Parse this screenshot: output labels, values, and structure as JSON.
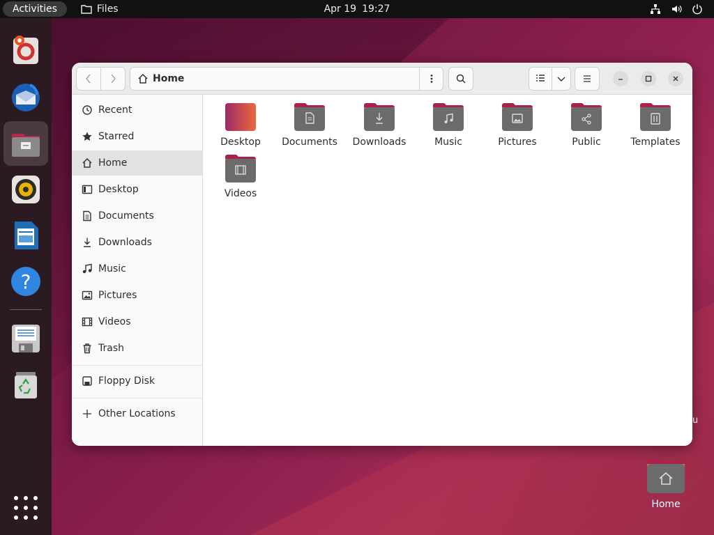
{
  "topbar": {
    "activities": "Activities",
    "app_name": "Files",
    "date": "Apr 19",
    "time": "19:27",
    "tray_icons": [
      "network-icon",
      "volume-icon",
      "power-icon"
    ]
  },
  "dock": {
    "items": [
      {
        "name": "help-lifebuoy",
        "icon": "lifebuoy-icon"
      },
      {
        "name": "thunderbird",
        "icon": "thunderbird-icon"
      },
      {
        "name": "files",
        "icon": "files-icon",
        "active": true
      },
      {
        "name": "rhythmbox",
        "icon": "speaker-icon"
      },
      {
        "name": "libreoffice-writer",
        "icon": "writer-icon"
      },
      {
        "name": "help",
        "icon": "help-icon"
      },
      {
        "name": "floppy-disk",
        "icon": "floppy-icon"
      },
      {
        "name": "trash",
        "icon": "trash-icon"
      }
    ],
    "show_apps": "apps-grid-icon"
  },
  "window": {
    "path": {
      "current": "Home"
    },
    "sidebar": {
      "items": [
        {
          "label": "Recent",
          "icon": "clock-icon"
        },
        {
          "label": "Starred",
          "icon": "star-icon"
        },
        {
          "label": "Home",
          "icon": "home-icon",
          "selected": true
        },
        {
          "label": "Desktop",
          "icon": "desktop-icon"
        },
        {
          "label": "Documents",
          "icon": "document-icon"
        },
        {
          "label": "Downloads",
          "icon": "download-icon"
        },
        {
          "label": "Music",
          "icon": "music-icon"
        },
        {
          "label": "Pictures",
          "icon": "picture-icon"
        },
        {
          "label": "Videos",
          "icon": "video-icon"
        },
        {
          "label": "Trash",
          "icon": "trash-icon"
        }
      ],
      "devices": [
        {
          "label": "Floppy Disk",
          "icon": "drive-icon"
        }
      ],
      "other": {
        "label": "Other Locations",
        "icon": "plus-icon"
      }
    },
    "files": [
      {
        "label": "Desktop",
        "emblem": "desktop"
      },
      {
        "label": "Documents",
        "emblem": "document"
      },
      {
        "label": "Downloads",
        "emblem": "download"
      },
      {
        "label": "Music",
        "emblem": "music"
      },
      {
        "label": "Pictures",
        "emblem": "picture"
      },
      {
        "label": "Public",
        "emblem": "share"
      },
      {
        "label": "Templates",
        "emblem": "template"
      },
      {
        "label": "Videos",
        "emblem": "video"
      }
    ]
  },
  "desktop": {
    "icons": [
      {
        "label": "Home"
      }
    ],
    "partial_text": "u"
  },
  "colors": {
    "accent": "#e95420",
    "folder_tab": "#a8234a",
    "folder_body": "#6b6b6b"
  }
}
